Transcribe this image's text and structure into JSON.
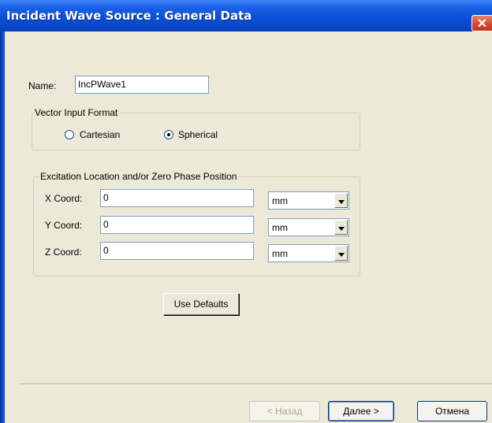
{
  "window": {
    "title": "Incident Wave Source : General Data",
    "close_symbol": "✕"
  },
  "name_field": {
    "label": "Name:",
    "value": "IncPWave1"
  },
  "vector_format": {
    "group_label": "Vector Input Format",
    "options": [
      {
        "label": "Cartesian",
        "selected": false
      },
      {
        "label": "Spherical",
        "selected": true
      }
    ]
  },
  "excitation": {
    "group_label": "Excitation Location and/or Zero Phase Position",
    "rows": [
      {
        "label": "X Coord:",
        "value": "0",
        "unit": "mm"
      },
      {
        "label": "Y Coord:",
        "value": "0",
        "unit": "mm"
      },
      {
        "label": "Z Coord:",
        "value": "0",
        "unit": "mm"
      }
    ]
  },
  "buttons": {
    "use_defaults": "Use Defaults",
    "back": "< Назад",
    "next": "Далее >",
    "cancel": "Отмена"
  }
}
